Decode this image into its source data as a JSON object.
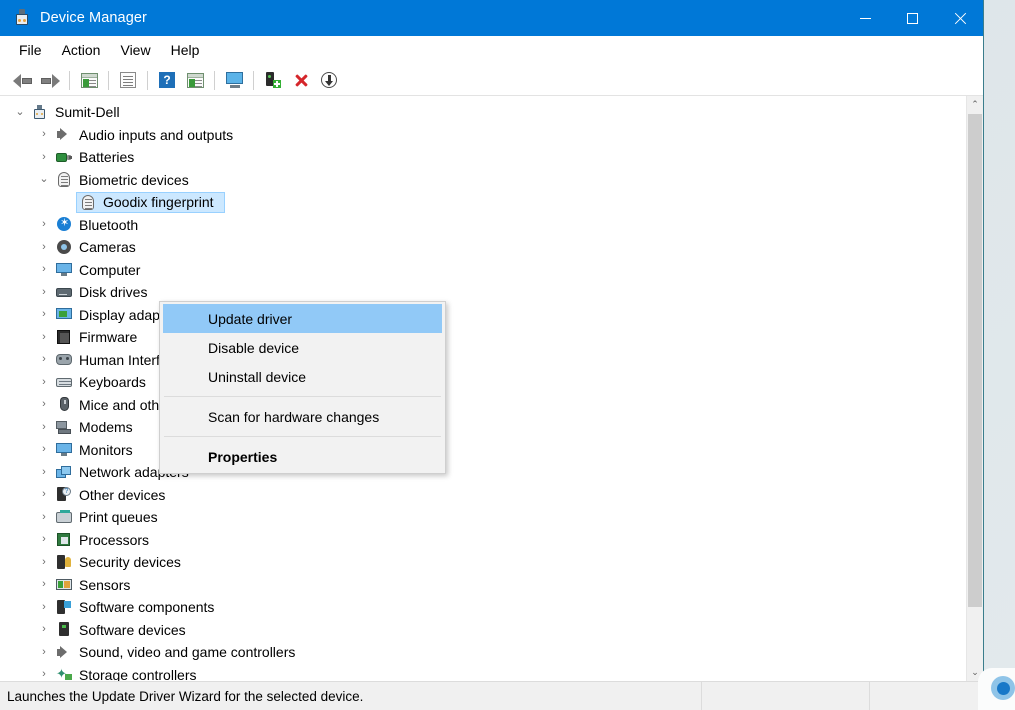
{
  "window": {
    "title": "Device Manager",
    "title_icon": "device-manager-icon",
    "controls": {
      "minimize": "Minimize",
      "maximize": "Maximize",
      "close": "Close"
    },
    "titlebar_color": "#0078d7"
  },
  "menubar": {
    "items": [
      {
        "label": "File"
      },
      {
        "label": "Action"
      },
      {
        "label": "View"
      },
      {
        "label": "Help"
      }
    ]
  },
  "toolbar": {
    "buttons": [
      {
        "name": "back-button",
        "icon": "arrow-left-icon"
      },
      {
        "name": "forward-button",
        "icon": "arrow-right-icon"
      },
      {
        "name": "show-hide-console-tree-button",
        "icon": "console-tree-icon"
      },
      {
        "name": "properties-button",
        "icon": "properties-icon"
      },
      {
        "name": "help-button",
        "icon": "help-question-icon"
      },
      {
        "name": "show-hide-action-pane-button",
        "icon": "action-pane-icon"
      },
      {
        "name": "update-driver-button",
        "icon": "monitor-scan-icon"
      },
      {
        "name": "enable-device-button",
        "icon": "enable-device-icon"
      },
      {
        "name": "uninstall-device-button",
        "icon": "red-x-icon"
      },
      {
        "name": "scan-for-hardware-changes-button",
        "icon": "download-circle-icon"
      }
    ]
  },
  "tree": {
    "root": {
      "label": "Sumit-Dell",
      "icon": "computer-icon",
      "expanded": true,
      "chevron": "⌄"
    },
    "items": [
      {
        "label": "Audio inputs and outputs",
        "icon": "speaker-icon",
        "indent": 1,
        "chevron": "›",
        "expanded": false,
        "selected": false
      },
      {
        "label": "Batteries",
        "icon": "battery-icon",
        "indent": 1,
        "chevron": "›",
        "expanded": false,
        "selected": false
      },
      {
        "label": "Biometric devices",
        "icon": "fingerprint-icon",
        "indent": 1,
        "chevron": "⌄",
        "expanded": true,
        "selected": false
      },
      {
        "label": "Goodix fingerprint",
        "icon": "fingerprint-icon",
        "indent": 2,
        "chevron": "",
        "expanded": false,
        "selected": true
      },
      {
        "label": "Bluetooth",
        "icon": "bluetooth-icon",
        "indent": 1,
        "chevron": "›",
        "expanded": false,
        "selected": false
      },
      {
        "label": "Cameras",
        "icon": "camera-icon",
        "indent": 1,
        "chevron": "›",
        "expanded": false,
        "selected": false
      },
      {
        "label": "Computer",
        "icon": "monitor-icon",
        "indent": 1,
        "chevron": "›",
        "expanded": false,
        "selected": false
      },
      {
        "label": "Disk drives",
        "icon": "disk-icon",
        "indent": 1,
        "chevron": "›",
        "expanded": false,
        "selected": false
      },
      {
        "label": "Display adapters",
        "icon": "display-adapter-icon",
        "indent": 1,
        "chevron": "›",
        "expanded": false,
        "selected": false
      },
      {
        "label": "Firmware",
        "icon": "chip-icon",
        "indent": 1,
        "chevron": "›",
        "expanded": false,
        "selected": false
      },
      {
        "label": "Human Interface Devices",
        "icon": "hid-icon",
        "indent": 1,
        "chevron": "›",
        "expanded": false,
        "selected": false
      },
      {
        "label": "Keyboards",
        "icon": "keyboard-icon",
        "indent": 1,
        "chevron": "›",
        "expanded": false,
        "selected": false
      },
      {
        "label": "Mice and other pointing devices",
        "icon": "mouse-icon",
        "indent": 1,
        "chevron": "›",
        "expanded": false,
        "selected": false
      },
      {
        "label": "Modems",
        "icon": "modem-icon",
        "indent": 1,
        "chevron": "›",
        "expanded": false,
        "selected": false
      },
      {
        "label": "Monitors",
        "icon": "monitor-icon",
        "indent": 1,
        "chevron": "›",
        "expanded": false,
        "selected": false
      },
      {
        "label": "Network adapters",
        "icon": "network-icon",
        "indent": 1,
        "chevron": "›",
        "expanded": false,
        "selected": false
      },
      {
        "label": "Other devices",
        "icon": "other-device-icon",
        "indent": 1,
        "chevron": "›",
        "expanded": false,
        "selected": false
      },
      {
        "label": "Print queues",
        "icon": "printer-icon",
        "indent": 1,
        "chevron": "›",
        "expanded": false,
        "selected": false
      },
      {
        "label": "Processors",
        "icon": "processor-icon",
        "indent": 1,
        "chevron": "›",
        "expanded": false,
        "selected": false
      },
      {
        "label": "Security devices",
        "icon": "security-icon",
        "indent": 1,
        "chevron": "›",
        "expanded": false,
        "selected": false
      },
      {
        "label": "Sensors",
        "icon": "sensor-icon",
        "indent": 1,
        "chevron": "›",
        "expanded": false,
        "selected": false
      },
      {
        "label": "Software components",
        "icon": "software-component-icon",
        "indent": 1,
        "chevron": "›",
        "expanded": false,
        "selected": false
      },
      {
        "label": "Software devices",
        "icon": "software-device-icon",
        "indent": 1,
        "chevron": "›",
        "expanded": false,
        "selected": false
      },
      {
        "label": "Sound, video and game controllers",
        "icon": "speaker-icon",
        "indent": 1,
        "chevron": "›",
        "expanded": false,
        "selected": false
      },
      {
        "label": "Storage controllers",
        "icon": "storage-icon",
        "indent": 1,
        "chevron": "›",
        "expanded": false,
        "selected": false
      }
    ]
  },
  "context_menu": {
    "items": [
      {
        "label": "Update driver",
        "highlighted": true,
        "bold": false,
        "separator_after": false
      },
      {
        "label": "Disable device",
        "highlighted": false,
        "bold": false,
        "separator_after": false
      },
      {
        "label": "Uninstall device",
        "highlighted": false,
        "bold": false,
        "separator_after": true
      },
      {
        "label": "Scan for hardware changes",
        "highlighted": false,
        "bold": false,
        "separator_after": true
      },
      {
        "label": "Properties",
        "highlighted": false,
        "bold": true,
        "separator_after": false
      }
    ],
    "highlight_color": "#91c9f7"
  },
  "statusbar": {
    "message": "Launches the Update Driver Wizard for the selected device."
  },
  "scrollbar": {
    "up_arrow": "⌃",
    "down_arrow": "⌄"
  },
  "cursor": {
    "name": "click-indicator",
    "color": "#1878c8"
  }
}
